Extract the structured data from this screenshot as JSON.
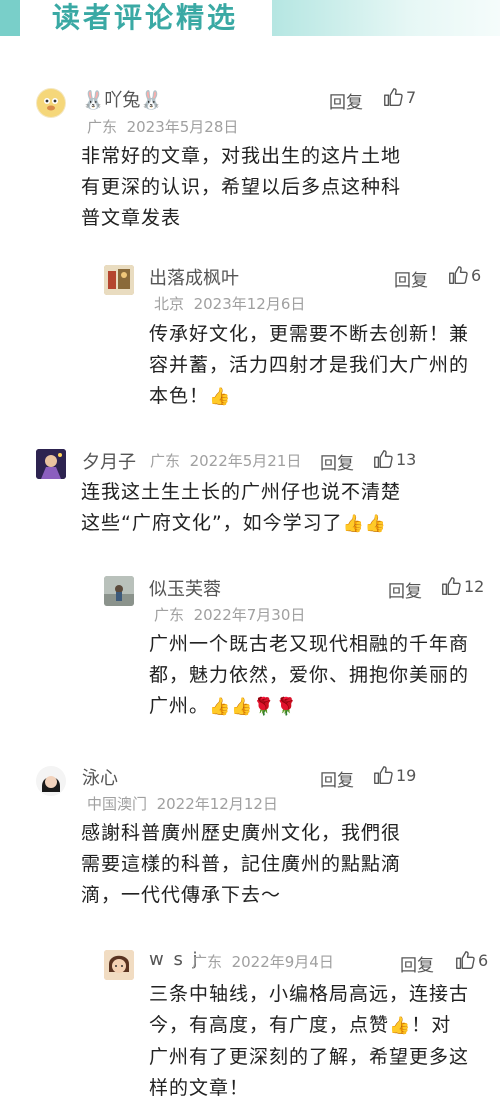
{
  "header": {
    "title": "读者评论精选"
  },
  "comments": [
    {
      "name": "🐰吖兔🐰",
      "location": "广东",
      "date": "2023年5月28日",
      "reply": "回复",
      "likes": "7",
      "lines": [
        "非常好的文章，对我出生的这片土地",
        "有更深的认识，希望以后多点这种科",
        "普文章发表"
      ],
      "reply_comment": {
        "name": "出落成枫叶",
        "location": "北京",
        "date": "2023年12月6日",
        "reply": "回复",
        "likes": "6",
        "lines": [
          "传承好文化，更需要不断去创新！兼",
          "容并蓄，活力四射才是我们大广州的",
          "本色！"
        ],
        "emoji": "👍"
      }
    },
    {
      "name": "夕月子",
      "location": "广东",
      "date": "2022年5月21日",
      "reply": "回复",
      "likes": "13",
      "lines": [
        "连我这土生土长的广州仔也说不清楚",
        "这些“广府文化”，如今学习了"
      ],
      "emoji": "👍👍",
      "reply_comment": {
        "name": "似玉芙蓉",
        "location": "广东",
        "date": "2022年7月30日",
        "reply": "回复",
        "likes": "12",
        "lines": [
          "广州一个既古老又现代相融的千年商",
          "都，魅力依然，爱你、拥抱你美丽的",
          "广州。"
        ],
        "emoji": "👍👍🌹🌹"
      }
    },
    {
      "name": "泳心",
      "location": "中国澳门",
      "date": "2022年12月12日",
      "reply": "回复",
      "likes": "19",
      "lines": [
        "感謝科普廣州歷史廣州文化，我們很",
        "需要這樣的科普，記住廣州的點點滴",
        "滴，一代代傳承下去～"
      ],
      "reply_comment": {
        "name": "w s j",
        "location": "广东",
        "date": "2022年9月4日",
        "reply": "回复",
        "likes": "6",
        "lines": [
          "三条中轴线，小编格局高远，连接古",
          "今，有高度，有广度，点赞",
          "广州有了更深刻的了解，希望更多这",
          "样的文章！"
        ],
        "emoji": "👍",
        "line2_tail": "！对"
      }
    }
  ]
}
